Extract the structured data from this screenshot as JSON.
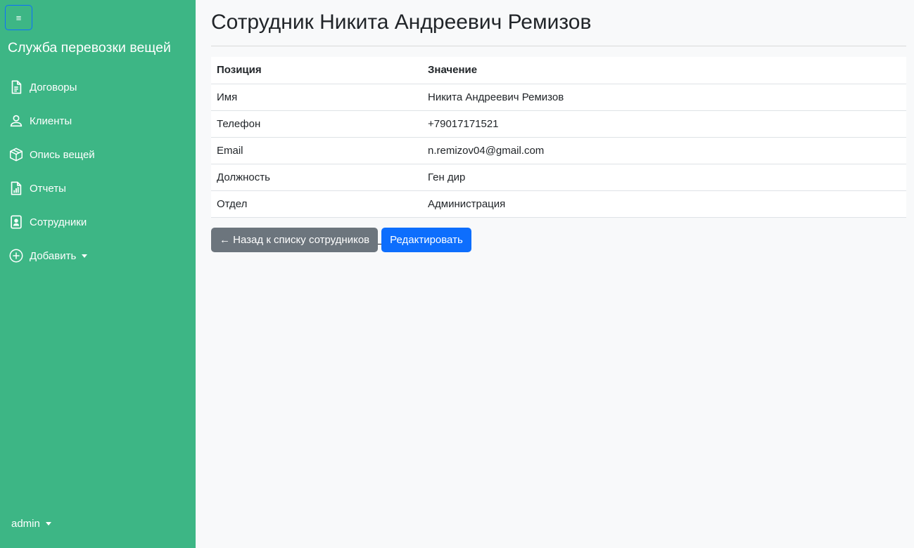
{
  "sidebar": {
    "toggle_label": "≡",
    "brand": "Служба перевозки вещей",
    "items": [
      {
        "label": "Договоры",
        "icon": "document-icon"
      },
      {
        "label": "Клиенты",
        "icon": "person-icon"
      },
      {
        "label": "Опись вещей",
        "icon": "box-icon"
      },
      {
        "label": "Отчеты",
        "icon": "report-icon"
      },
      {
        "label": "Сотрудники",
        "icon": "badge-icon"
      },
      {
        "label": "Добавить",
        "icon": "plus-circle-icon"
      }
    ],
    "user": "admin"
  },
  "main": {
    "title": "Сотрудник Никита Андреевич Ремизов",
    "table": {
      "headers": [
        "Позиция",
        "Значение"
      ],
      "rows": [
        [
          "Имя",
          "Никита Андреевич Ремизов"
        ],
        [
          "Телефон",
          "+79017171521"
        ],
        [
          "Email",
          "n.remizov04@gmail.com"
        ],
        [
          "Должность",
          "Ген дир"
        ],
        [
          "Отдел",
          "Администрация"
        ]
      ]
    },
    "back_button": "← Назад к списку сотрудников",
    "edit_button": "Редактировать"
  },
  "colors": {
    "sidebar_bg": "#3db685",
    "primary": "#0d6efd",
    "secondary": "#6c757d",
    "page_bg": "#f8f9fa"
  }
}
